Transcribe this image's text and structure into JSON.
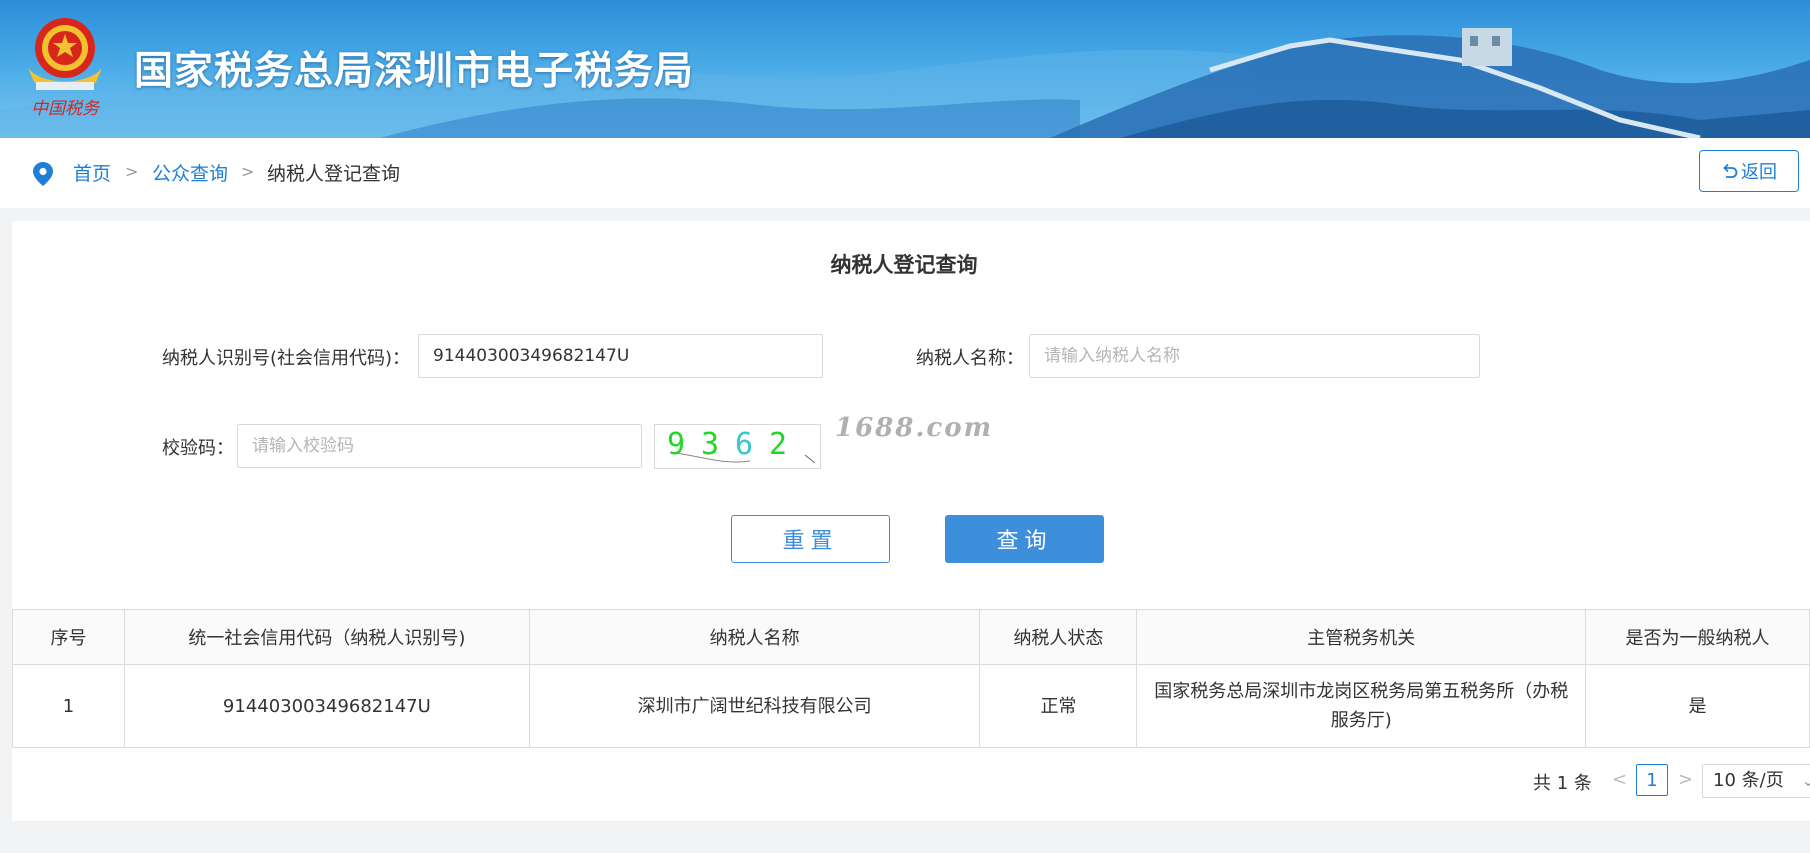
{
  "header": {
    "site_title": "国家税务总局深圳市电子税务局",
    "emblem_caption": "中国税务"
  },
  "breadcrumb": {
    "items": [
      "首页",
      "公众查询",
      "纳税人登记查询"
    ],
    "separator": ">",
    "back_label": "返回"
  },
  "form": {
    "title": "纳税人登记查询",
    "taxpayer_id_label": "纳税人识别号(社会信用代码)：",
    "taxpayer_id_value": "91440300349682147U",
    "taxpayer_name_label": "纳税人名称：",
    "taxpayer_name_placeholder": "请输入纳税人名称",
    "captcha_label": "校验码：",
    "captcha_placeholder": "请输入校验码",
    "captcha_chars": [
      "9",
      "3",
      "6",
      "2"
    ],
    "reset_label": "重置",
    "query_label": "查询"
  },
  "watermark": "1688.com",
  "table": {
    "headers": [
      "序号",
      "统一社会信用代码（纳税人识别号)",
      "纳税人名称",
      "纳税人状态",
      "主管税务机关",
      "是否为一般纳税人"
    ],
    "rows": [
      [
        "1",
        "91440300349682147U",
        "深圳市广阔世纪科技有限公司",
        "正常",
        "国家税务总局深圳市龙岗区税务局第五税务所（办税服务厅)",
        "是"
      ]
    ]
  },
  "pagination": {
    "total_label": "共 1 条",
    "current_page": "1",
    "page_size_label": "10 条/页"
  },
  "colors": {
    "primary": "#3d8fdb",
    "link": "#1f7fd6",
    "captcha_green": "#22d62a",
    "captcha_cyan": "#3ac7d0"
  }
}
